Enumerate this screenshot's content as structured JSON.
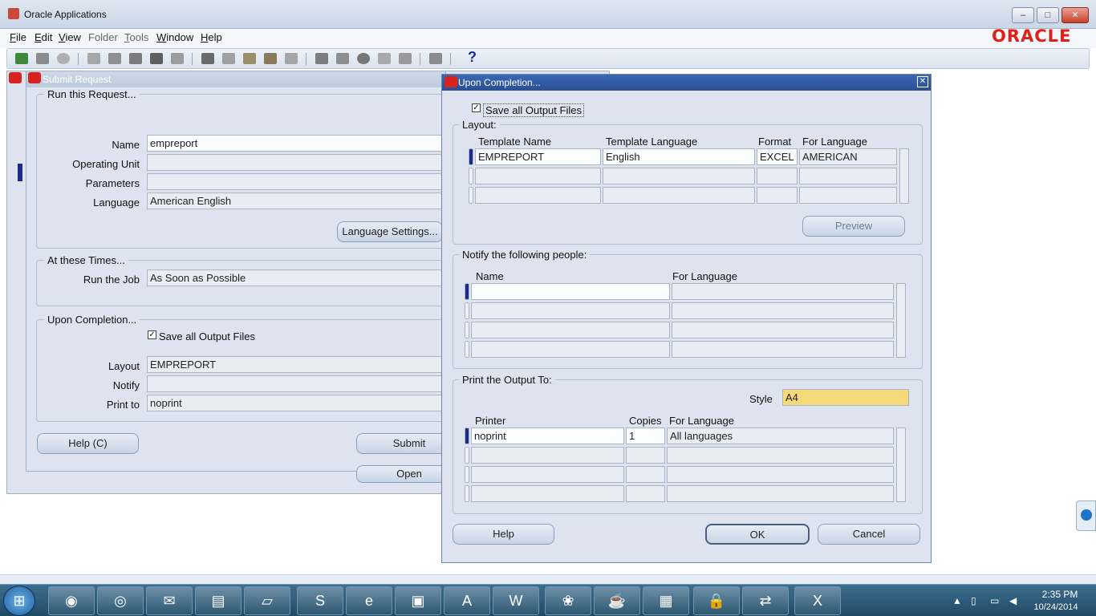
{
  "app": {
    "title": "Oracle Applications",
    "logo": "ORACLE",
    "minimize": "–",
    "maximize": "□",
    "close": "✕"
  },
  "menu": [
    {
      "label": "File",
      "mn": "F",
      "rest": "ile"
    },
    {
      "label": "Edit",
      "mn": "E",
      "rest": "dit"
    },
    {
      "label": "View",
      "mn": "V",
      "rest": "iew"
    },
    {
      "label": "Folder",
      "mn": "",
      "rest": "Folder"
    },
    {
      "label": "Tools",
      "mn": "T",
      "rest": "ools"
    },
    {
      "label": "Window",
      "mn": "W",
      "rest": "indow"
    },
    {
      "label": "Help",
      "mn": "H",
      "rest": "elp"
    }
  ],
  "toolbar": {
    "help_glyph": "?"
  },
  "submit": {
    "title": "Submit Request",
    "run_group": "Run this Request...",
    "name_label": "Name",
    "name_value": "empreport",
    "ou_label": "Operating Unit",
    "ou_value": "",
    "params_label": "Parameters",
    "params_value": "",
    "lang_label": "Language",
    "lang_value": "American English",
    "lang_settings_btn": "Language Settings...",
    "times_group": "At these Times...",
    "runjob_label": "Run the Job",
    "runjob_value": "As Soon as Possible",
    "upon_group": "Upon Completion...",
    "save_output": "Save all Output Files",
    "layout_label": "Layout",
    "layout_value": "EMPREPORT",
    "notify_label": "Notify",
    "notify_value": "",
    "printto_label": "Print to",
    "printto_value": "noprint",
    "help_btn": "Help (C)",
    "submit_btn": "Submit",
    "open_btn": "Open"
  },
  "upon": {
    "title": "Upon Completion...",
    "save_output": "Save all Output Files",
    "layout_group": "Layout:",
    "layout_headers": {
      "template": "Template Name",
      "language": "Template Language",
      "format": "Format",
      "for_lang": "For Language"
    },
    "layout_rows": [
      {
        "template": "EMPREPORT",
        "language": "English",
        "format": "EXCEL",
        "for_lang": "AMERICAN"
      },
      {
        "template": "",
        "language": "",
        "format": "",
        "for_lang": ""
      },
      {
        "template": "",
        "language": "",
        "format": "",
        "for_lang": ""
      }
    ],
    "preview_btn": "Preview",
    "notify_group": "Notify the following people:",
    "notify_headers": {
      "name": "Name",
      "for_lang": "For Language"
    },
    "print_group": "Print the Output To:",
    "style_label": "Style",
    "style_value": "A4",
    "print_headers": {
      "printer": "Printer",
      "copies": "Copies",
      "for_lang": "For Language"
    },
    "print_rows": [
      {
        "printer": "noprint",
        "copies": "1",
        "for_lang": "All languages"
      },
      {
        "printer": "",
        "copies": "",
        "for_lang": ""
      },
      {
        "printer": "",
        "copies": "",
        "for_lang": ""
      },
      {
        "printer": "",
        "copies": "",
        "for_lang": ""
      }
    ],
    "help_btn": "Help",
    "ok_btn": "OK",
    "cancel_btn": "Cancel"
  },
  "taskbar": {
    "start": "⊞",
    "time": "2:35 PM",
    "date": "10/24/2014"
  },
  "colors": {
    "accent": "#1c2a8a",
    "oracle_red": "#e0201b",
    "style_yellow": "#f5d97a"
  }
}
